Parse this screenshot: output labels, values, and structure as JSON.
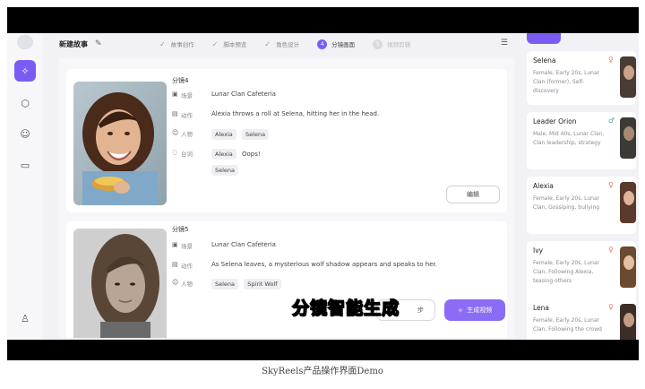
{
  "caption": "SkyReels产品操作界面Demo",
  "header": {
    "title": "新建故事",
    "steps": [
      {
        "label": "故事创作",
        "state": "done"
      },
      {
        "label": "脚本预览",
        "state": "done"
      },
      {
        "label": "角色设计",
        "state": "done"
      },
      {
        "label": "分镜画面",
        "state": "current",
        "num": "4"
      },
      {
        "label": "视频剪辑",
        "state": "todo",
        "num": "5"
      }
    ]
  },
  "field_labels": {
    "scene": "场景",
    "action": "动作",
    "characters": "人物",
    "dialogue": "台词"
  },
  "shots": [
    {
      "label": "分镜4",
      "scene": "Lunar Clan Cafeteria",
      "action": "Alexia throws a roll at Selena, hitting her in the head.",
      "characters": [
        "Alexia",
        "Selena"
      ],
      "dialogue": [
        {
          "speaker": "Alexia",
          "text": "Oops!"
        },
        {
          "speaker": "Selena",
          "text": ""
        }
      ],
      "edit_label": "编辑"
    },
    {
      "label": "分镜5",
      "scene": "Lunar Clan Cafeteria",
      "action": "As Selena leaves, a mysterious wolf shadow appears and speaks to her.",
      "characters": [
        "Selena",
        "Spirit Wolf"
      ]
    }
  ],
  "characters": [
    {
      "name": "Selena",
      "gender": "female",
      "desc": "Female, Early 20s, Lunar Clan (former), Self-discovery"
    },
    {
      "name": "Leader Orion",
      "gender": "male",
      "desc": "Male, Mid 40s, Lunar Clan, Clan leadership, strategy"
    },
    {
      "name": "Alexia",
      "gender": "female",
      "desc": "Female, Early 20s, Lunar Clan, Gossiping, bullying"
    },
    {
      "name": "Ivy",
      "gender": "female",
      "desc": "Female, Early 20s, Lunar Clan, Following Alexia, teasing others"
    },
    {
      "name": "Lena",
      "gender": "female",
      "desc": "Female, Early 20s, Lunar Clan, Following the crowd"
    }
  ],
  "bottom": {
    "prev_label": "步",
    "generate_label": "生成视频"
  },
  "subtitle": "分镜智能生成",
  "colors": {
    "accent": "#7a5cf5",
    "female": "#e07a5f",
    "male": "#4aa3a0",
    "subtitle": "#e8e02a"
  }
}
